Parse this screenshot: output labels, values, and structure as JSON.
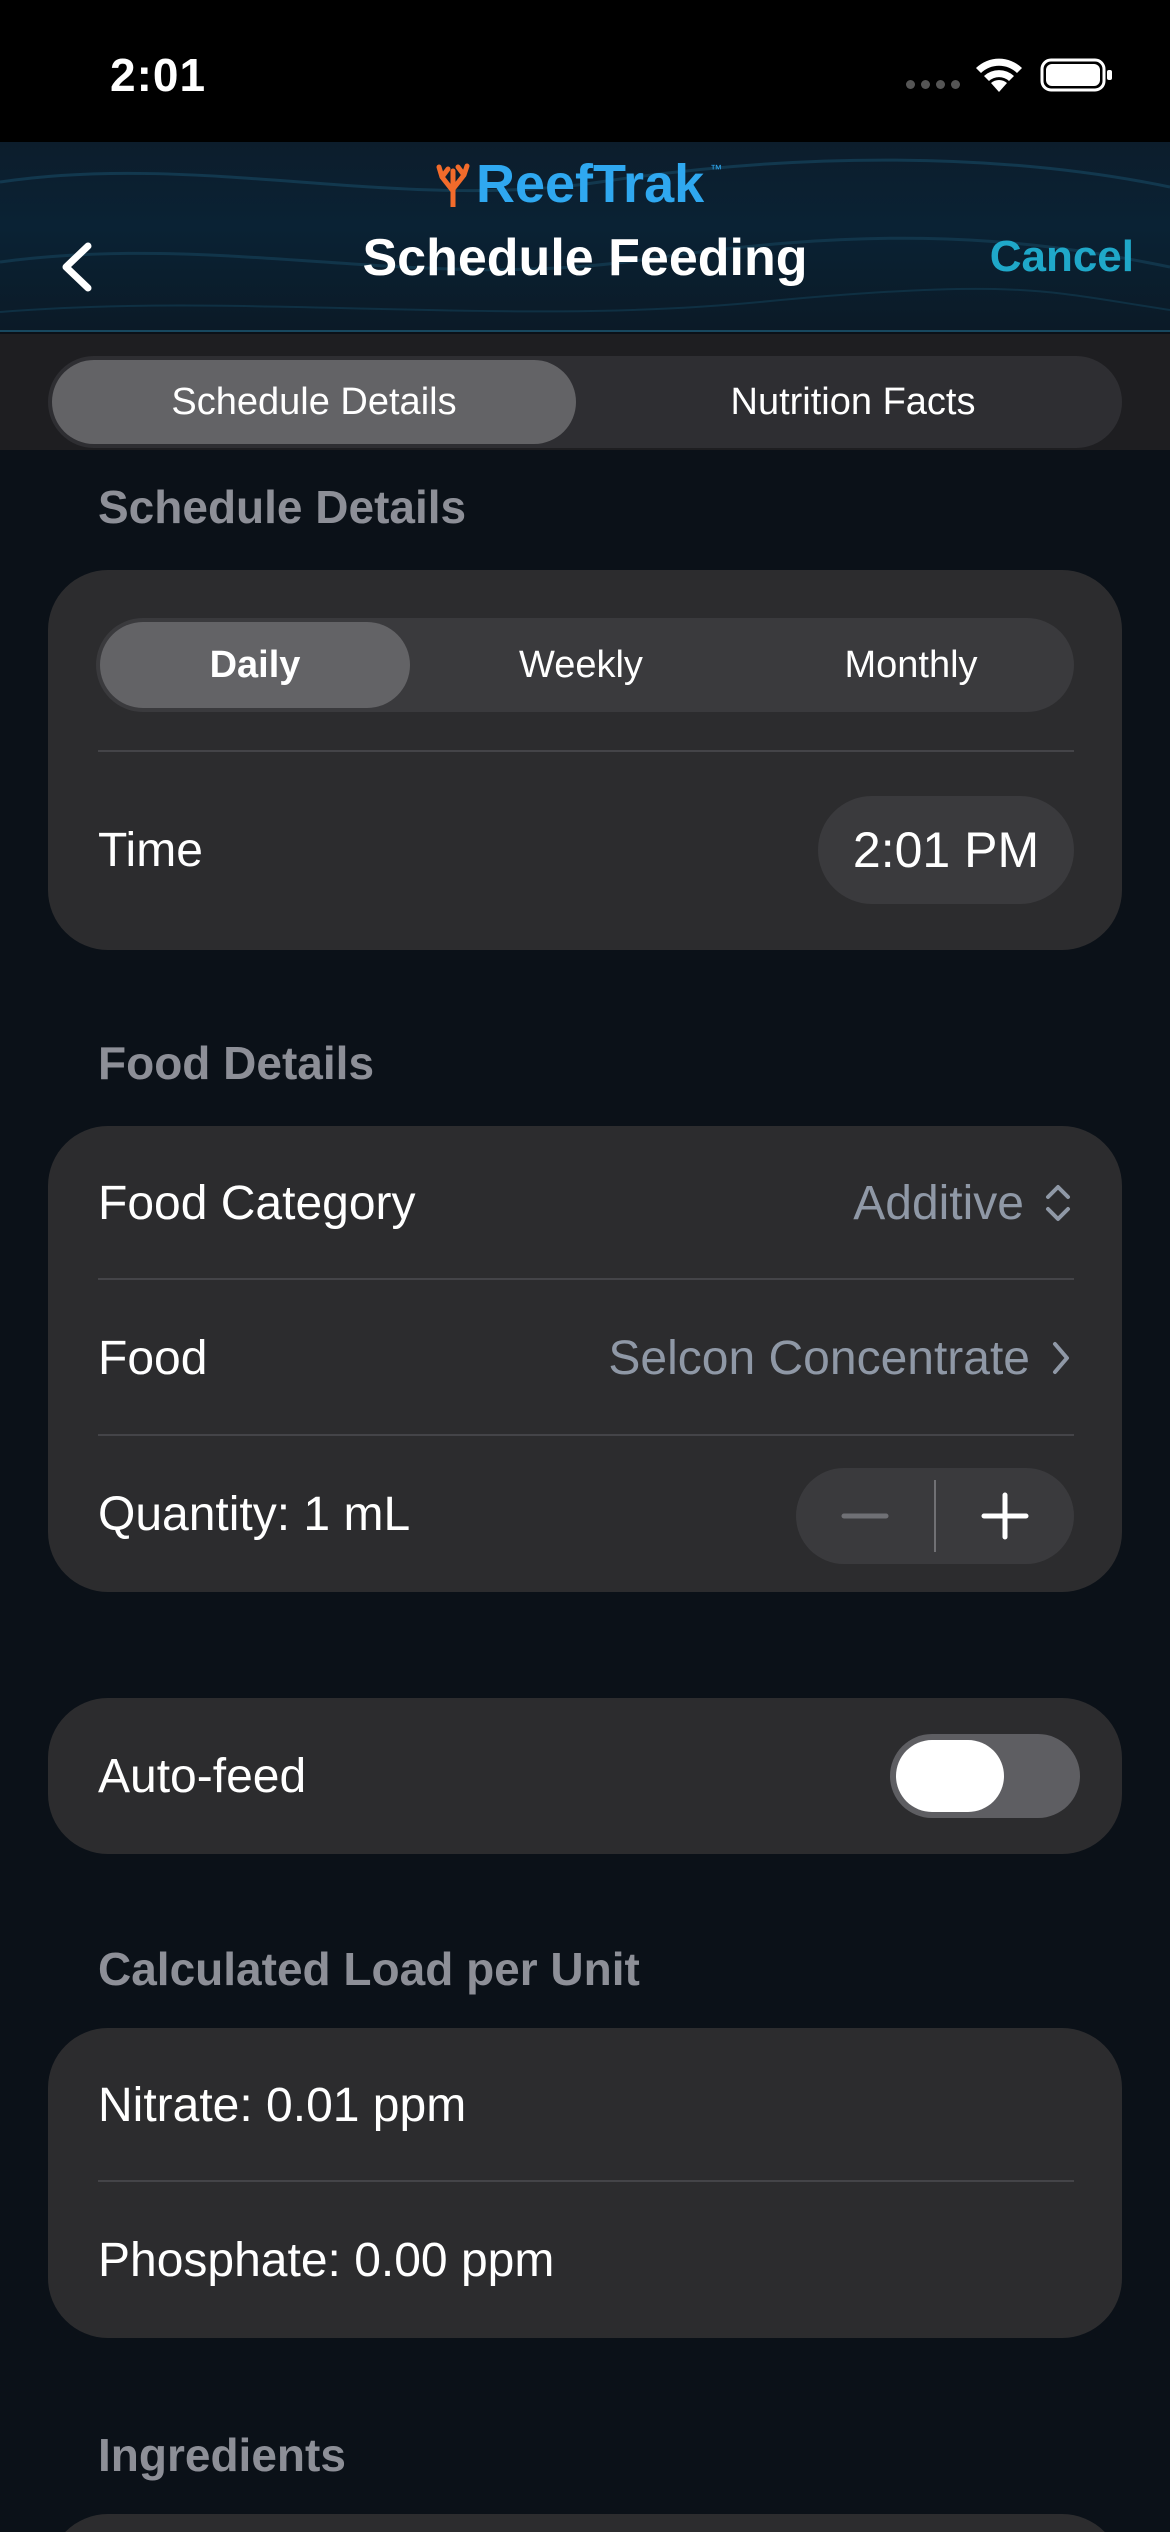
{
  "status_bar": {
    "time": "2:01"
  },
  "header": {
    "logo_text": "ReefTrak",
    "logo_tm": "™",
    "title": "Schedule Feeding",
    "cancel_label": "Cancel"
  },
  "tabs": [
    {
      "label": "Schedule Details",
      "active": true
    },
    {
      "label": "Nutrition Facts",
      "active": false
    }
  ],
  "schedule_section": {
    "title": "Schedule Details",
    "frequency_options": [
      {
        "label": "Daily",
        "active": true
      },
      {
        "label": "Weekly",
        "active": false
      },
      {
        "label": "Monthly",
        "active": false
      }
    ],
    "time_label": "Time",
    "time_value": "2:01 PM"
  },
  "food_section": {
    "title": "Food Details",
    "category_label": "Food Category",
    "category_value": "Additive",
    "food_label": "Food",
    "food_value": "Selcon Concentrate",
    "quantity_label": "Quantity: 1 mL"
  },
  "autofeed": {
    "label": "Auto-feed",
    "enabled": false
  },
  "load_section": {
    "title": "Calculated Load per Unit",
    "nitrate": "Nitrate: 0.01 ppm",
    "phosphate": "Phosphate: 0.00 ppm"
  },
  "ingredients_section": {
    "title": "Ingredients"
  },
  "colors": {
    "accent": "#1fa8c9",
    "logo": "#2fa8f0",
    "card": "#2c2c2e",
    "section_title": "#8d8f97"
  },
  "icons": {
    "back": "chevron-left-icon",
    "up_down": "chevron-up-down-icon",
    "disclosure": "chevron-right-icon",
    "minus": "minus-icon",
    "plus": "plus-icon"
  }
}
